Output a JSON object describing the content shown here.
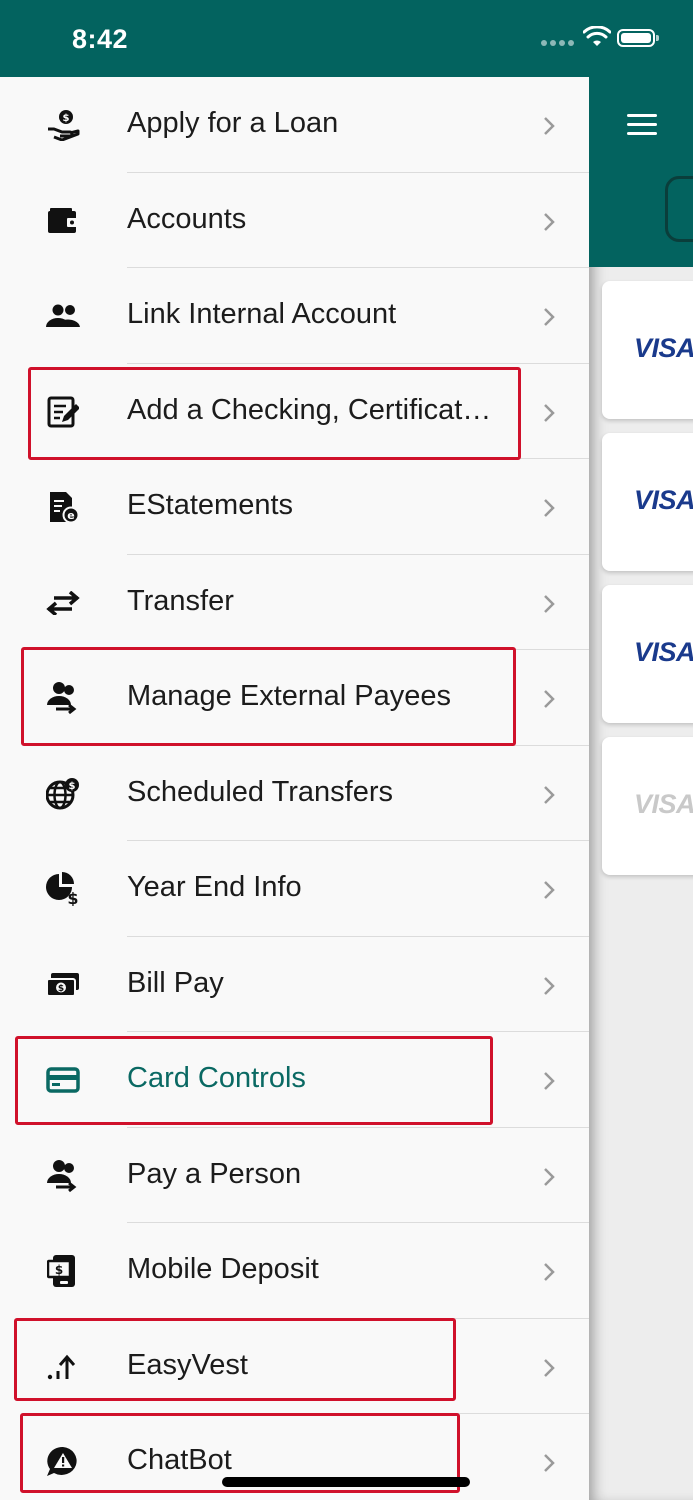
{
  "status_bar": {
    "time": "8:42"
  },
  "drawer": {
    "items": [
      {
        "label": "Apply for a Loan",
        "icon": "hand-money-icon"
      },
      {
        "label": "Accounts",
        "icon": "wallet-icon"
      },
      {
        "label": "Link Internal Account",
        "icon": "people-icon"
      },
      {
        "label": "Add a Checking, Certificat…",
        "icon": "edit-document-icon"
      },
      {
        "label": "EStatements",
        "icon": "estatement-icon"
      },
      {
        "label": "Transfer",
        "icon": "transfer-arrows-icon"
      },
      {
        "label": "Manage External Payees",
        "icon": "payees-icon"
      },
      {
        "label": "Scheduled Transfers",
        "icon": "globe-dollar-icon"
      },
      {
        "label": "Year End Info",
        "icon": "pie-dollar-icon"
      },
      {
        "label": "Bill Pay",
        "icon": "cash-icon"
      },
      {
        "label": "Card Controls",
        "icon": "credit-card-icon",
        "active": true
      },
      {
        "label": "Pay a Person",
        "icon": "pay-person-icon"
      },
      {
        "label": "Mobile Deposit",
        "icon": "mobile-check-icon"
      },
      {
        "label": "EasyVest",
        "icon": "trend-up-icon"
      },
      {
        "label": "ChatBot",
        "icon": "chat-alert-icon"
      }
    ]
  },
  "main": {
    "cards": [
      {
        "brand": "VISA"
      },
      {
        "brand": "VISA"
      },
      {
        "brand": "VISA"
      },
      {
        "brand": "VISA"
      }
    ]
  },
  "colors": {
    "header": "#03635f",
    "active": "#0a6963",
    "highlight": "#d0112b",
    "visa": "#1a3a8c"
  }
}
